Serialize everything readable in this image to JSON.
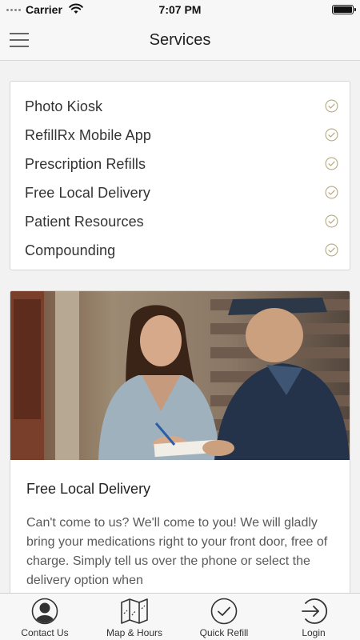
{
  "status_bar": {
    "carrier": "Carrier",
    "time": "7:07 PM"
  },
  "header": {
    "title": "Services"
  },
  "services": [
    {
      "label": "Photo Kiosk",
      "icon": "check-circle-icon"
    },
    {
      "label": "RefillRx Mobile App",
      "icon": "check-circle-icon"
    },
    {
      "label": "Prescription Refills",
      "icon": "check-circle-icon"
    },
    {
      "label": "Free Local Delivery",
      "icon": "check-circle-icon"
    },
    {
      "label": "Patient Resources",
      "icon": "check-circle-icon"
    },
    {
      "label": "Compounding",
      "icon": "check-circle-icon"
    }
  ],
  "feature": {
    "title": "Free Local Delivery",
    "text": "Can't come to us? We'll come to you! We will gladly bring your medications right to your front door, free of charge. Simply tell us over the phone or select the delivery option when"
  },
  "tab_bar": [
    {
      "label": "Contact Us",
      "icon": "person-icon"
    },
    {
      "label": "Map & Hours",
      "icon": "map-icon"
    },
    {
      "label": "Quick Refill",
      "icon": "check-circle-icon"
    },
    {
      "label": "Login",
      "icon": "login-icon"
    }
  ],
  "colors": {
    "background": "#f2f2f2",
    "card": "#ffffff",
    "bar": "#f7f7f7",
    "check": "#b8a87a"
  }
}
